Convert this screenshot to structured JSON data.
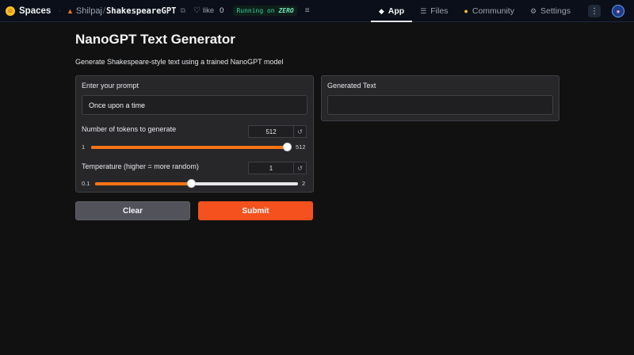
{
  "topbar": {
    "brand": "Spaces",
    "repo_owner": "Shilpaj",
    "repo_name": "ShakespeareGPT",
    "like_label": "like",
    "like_count": "0",
    "status_prefix": "Running on",
    "status_hardware": "ZERO",
    "nav": [
      {
        "label": "App",
        "icon": "cube-icon",
        "active": true
      },
      {
        "label": "Files",
        "icon": "files-icon",
        "active": false
      },
      {
        "label": "Community",
        "icon": "community-icon",
        "active": false
      },
      {
        "label": "Settings",
        "icon": "gear-icon",
        "active": false
      }
    ]
  },
  "app": {
    "title": "NanoGPT Text Generator",
    "description": "Generate Shakespeare-style text using a trained NanoGPT model",
    "prompt": {
      "label": "Enter your prompt",
      "value": "Once upon a time"
    },
    "tokens": {
      "label": "Number of tokens to generate",
      "value": "512",
      "min": "1",
      "max": "512",
      "fraction": 1.0
    },
    "temperature": {
      "label": "Temperature (higher = more random)",
      "value": "1",
      "min": "0.1",
      "max": "2",
      "fraction": 0.474
    },
    "output": {
      "label": "Generated Text",
      "value": ""
    },
    "buttons": {
      "clear": "Clear",
      "submit": "Submit"
    }
  },
  "colors": {
    "accent": "#f97316",
    "submit": "#f4511e",
    "background": "#111111",
    "panel": "#27272a"
  }
}
